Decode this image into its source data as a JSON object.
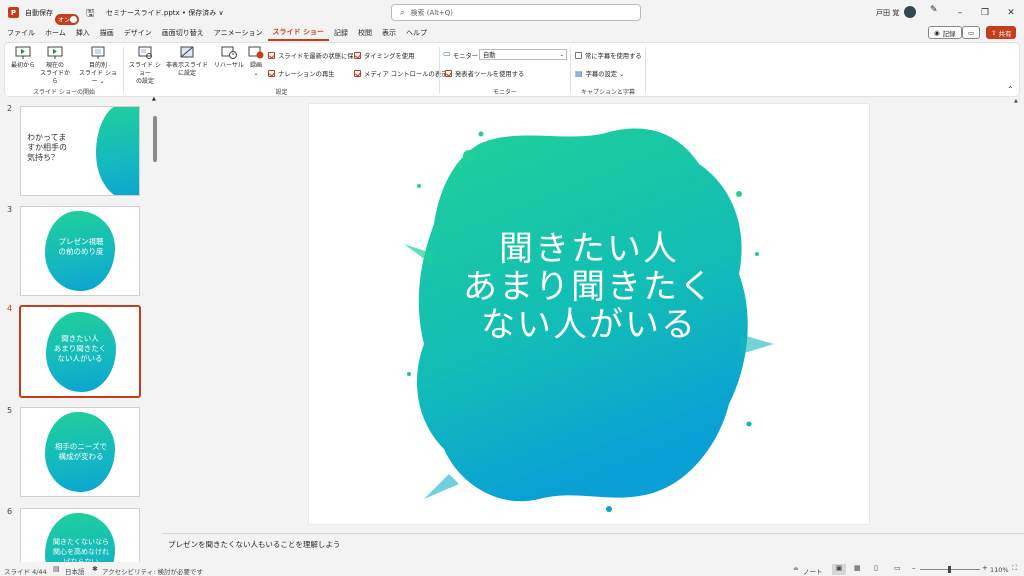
{
  "titlebar": {
    "autosave_label": "自動保存",
    "autosave_state": "オン",
    "file_name": "セミナースライド.pptx • 保存済み ∨",
    "search_placeholder": "検索 (Alt+Q)",
    "user_name": "戸田 覚"
  },
  "tabs": [
    "ファイル",
    "ホーム",
    "挿入",
    "描画",
    "デザイン",
    "画面切り替え",
    "アニメーション",
    "スライド ショー",
    "記録",
    "校閲",
    "表示",
    "ヘルプ"
  ],
  "active_tab": "スライド ショー",
  "tab_actions": {
    "record": "記録",
    "share": "共有"
  },
  "ribbon": {
    "start_group": {
      "label": "スライド ショーの開始",
      "buttons": [
        "最初から",
        "現在の\nスライドから",
        "目的別\nスライド ショー ⌄"
      ]
    },
    "settings_group": {
      "label": "設定",
      "buttons": [
        "スライド ショー\nの設定",
        "非表示スライド\nに設定",
        "リハーサル",
        "録画\n⌄"
      ],
      "checks": [
        {
          "label": "スライドを最新の状態に保つ",
          "checked": true
        },
        {
          "label": "ナレーションの再生",
          "checked": true
        },
        {
          "label": "タイミングを使用",
          "checked": true
        },
        {
          "label": "メディア コントロールの表示",
          "checked": true
        }
      ]
    },
    "monitor_group": {
      "label": "モニター",
      "monitor_label": "モニター:",
      "monitor_value": "自動",
      "presenter_view": "発表者ツールを使用する"
    },
    "caption_group": {
      "label": "キャプションと字幕",
      "always_caption": "常に字幕を使用する",
      "caption_settings": "字幕の設定 ⌄"
    }
  },
  "thumbnails": [
    {
      "number": "2",
      "text": "わかってま\nすか相手の\n気持ち？"
    },
    {
      "number": "3",
      "text": "プレゼン視聴\nの前のめり度"
    },
    {
      "number": "4",
      "text": "聞きたい人\nあまり聞きたく\nない人がいる"
    },
    {
      "number": "5",
      "text": "相手のニーズで\n構成が変わる"
    },
    {
      "number": "6",
      "text": "聞きたくないなら\n関心を高めなけれ\nばならない"
    }
  ],
  "slide": {
    "line1": "聞きたい人",
    "line2": "あまり聞きたく",
    "line3": "ない人がいる"
  },
  "notes": "プレゼンを聞きたくない人もいることを理解しよう",
  "status": {
    "slide_info": "スライド 4/44",
    "language": "日本語",
    "accessibility": "アクセシビリティ: 検討が必要です",
    "notes_button": "ノート",
    "zoom": "110%"
  },
  "colors": {
    "accent": "#c43e1c",
    "blob_start": "#20d197",
    "blob_end": "#0aa3d3"
  }
}
